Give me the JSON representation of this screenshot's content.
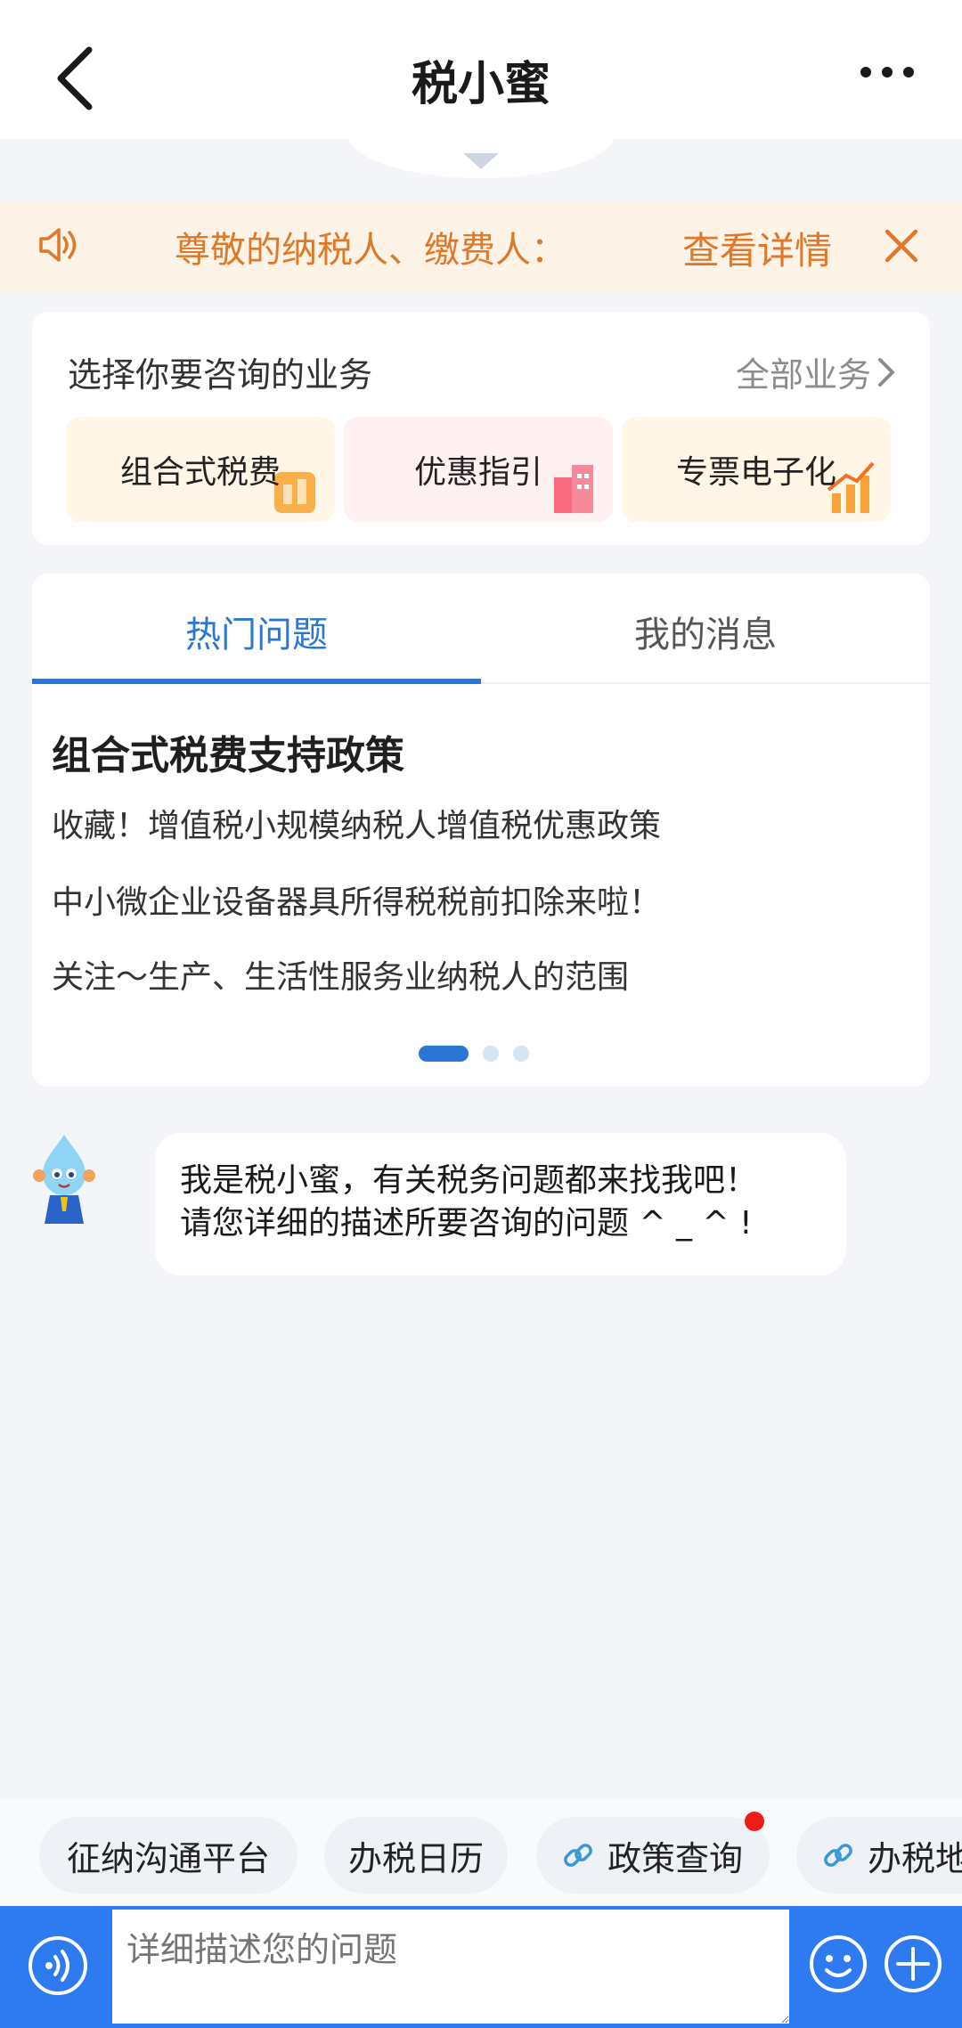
{
  "header": {
    "title": "税小蜜"
  },
  "notice": {
    "text": "尊敬的纳税人、缴费人：",
    "detail_label": "查看详情"
  },
  "business": {
    "prompt": "选择你要咨询的业务",
    "all_label": "全部业务",
    "tiles": [
      {
        "label": "组合式税费"
      },
      {
        "label": "优惠指引"
      },
      {
        "label": "专票电子化"
      }
    ]
  },
  "tabs": {
    "active": "热门问题",
    "inactive": "我的消息"
  },
  "hot": {
    "section_title": "组合式税费支持政策",
    "questions": [
      "收藏！增值税小规模纳税人增值税优惠政策",
      "中小微企业设备器具所得税税前扣除来啦！",
      "关注～生产、生活性服务业纳税人的范围"
    ]
  },
  "chat": {
    "line1": "我是税小蜜，有关税务问题都来找我吧！",
    "line2": "请您详细的描述所要咨询的问题 ^ _ ^ !"
  },
  "quick": {
    "items": [
      "征纳沟通平台",
      "办税日历",
      "政策查询",
      "办税地"
    ]
  },
  "input": {
    "placeholder": "详细描述您的问题"
  },
  "colors": {
    "accent": "#2a76d2",
    "notice": "#e0782a",
    "bar": "#2e7af0"
  }
}
